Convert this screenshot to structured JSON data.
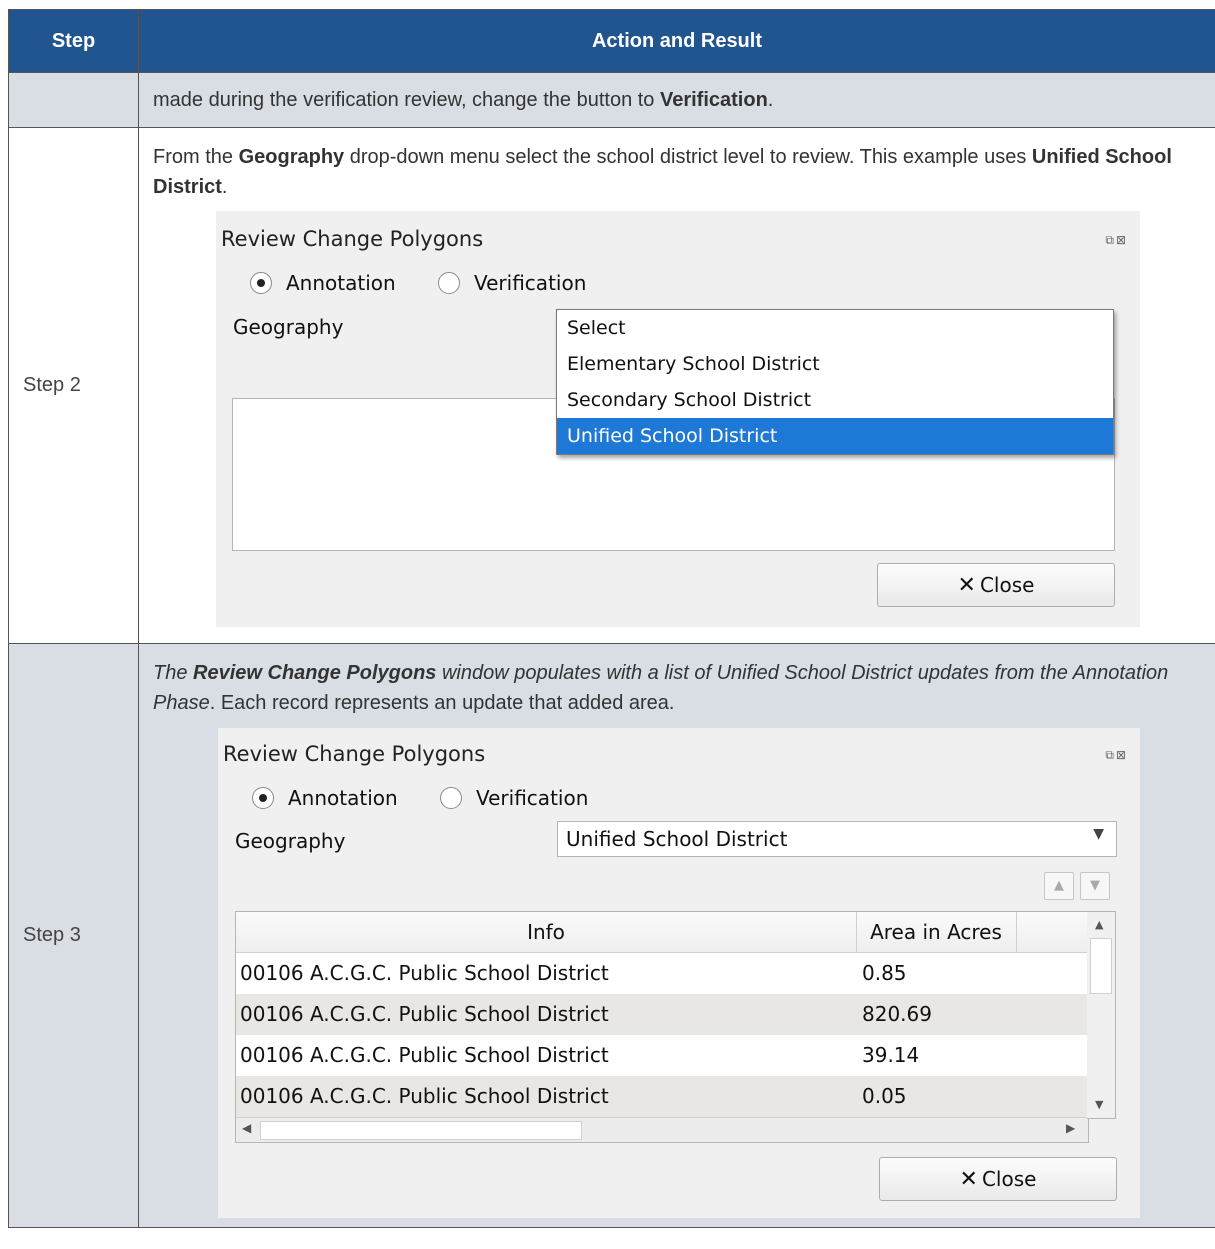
{
  "header": {
    "col_step": "Step",
    "col_action": "Action and Result"
  },
  "row1": {
    "text_pre": "made during the verification review, change the button to ",
    "text_bold": "Verification",
    "text_post": "."
  },
  "row2": {
    "step": "Step 2",
    "t1": "From the ",
    "b1": "Geography",
    "t2": " drop-down menu select the school district level to review. This example uses ",
    "b2": "Unified School District",
    "t3": ".",
    "dialog": {
      "title": "Review Change Polygons",
      "radio_annotation": "Annotation",
      "radio_verification": "Verification",
      "geography_label": "Geography",
      "dropdown_options": [
        "Select",
        "Elementary School District",
        "Secondary School District",
        "Unified School District"
      ],
      "selected_option": "Unified School District",
      "close_label": "Close"
    }
  },
  "row3": {
    "step": "Step 3",
    "i1": "The ",
    "bi1": "Review Change Polygons",
    "i2": " window populates with a list of Unified School District updates from the Annotation Phase",
    "t1": ". Each record represents an update that added area.",
    "dialog": {
      "title": "Review Change Polygons",
      "radio_annotation": "Annotation",
      "radio_verification": "Verification",
      "geography_label": "Geography",
      "geography_value": "Unified School District",
      "col_info": "Info",
      "col_area": "Area in Acres",
      "rows": [
        {
          "info": "00106 A.C.G.C. Public School District",
          "area": "0.85"
        },
        {
          "info": "00106 A.C.G.C. Public School District",
          "area": "820.69"
        },
        {
          "info": "00106 A.C.G.C. Public School District",
          "area": "39.14"
        },
        {
          "info": "00106 A.C.G.C. Public School District",
          "area": "0.05"
        }
      ],
      "close_label": "Close"
    }
  },
  "colors": {
    "header_bg": "#215590",
    "row_shade": "#d9dde4",
    "selection": "#1e78d6"
  }
}
